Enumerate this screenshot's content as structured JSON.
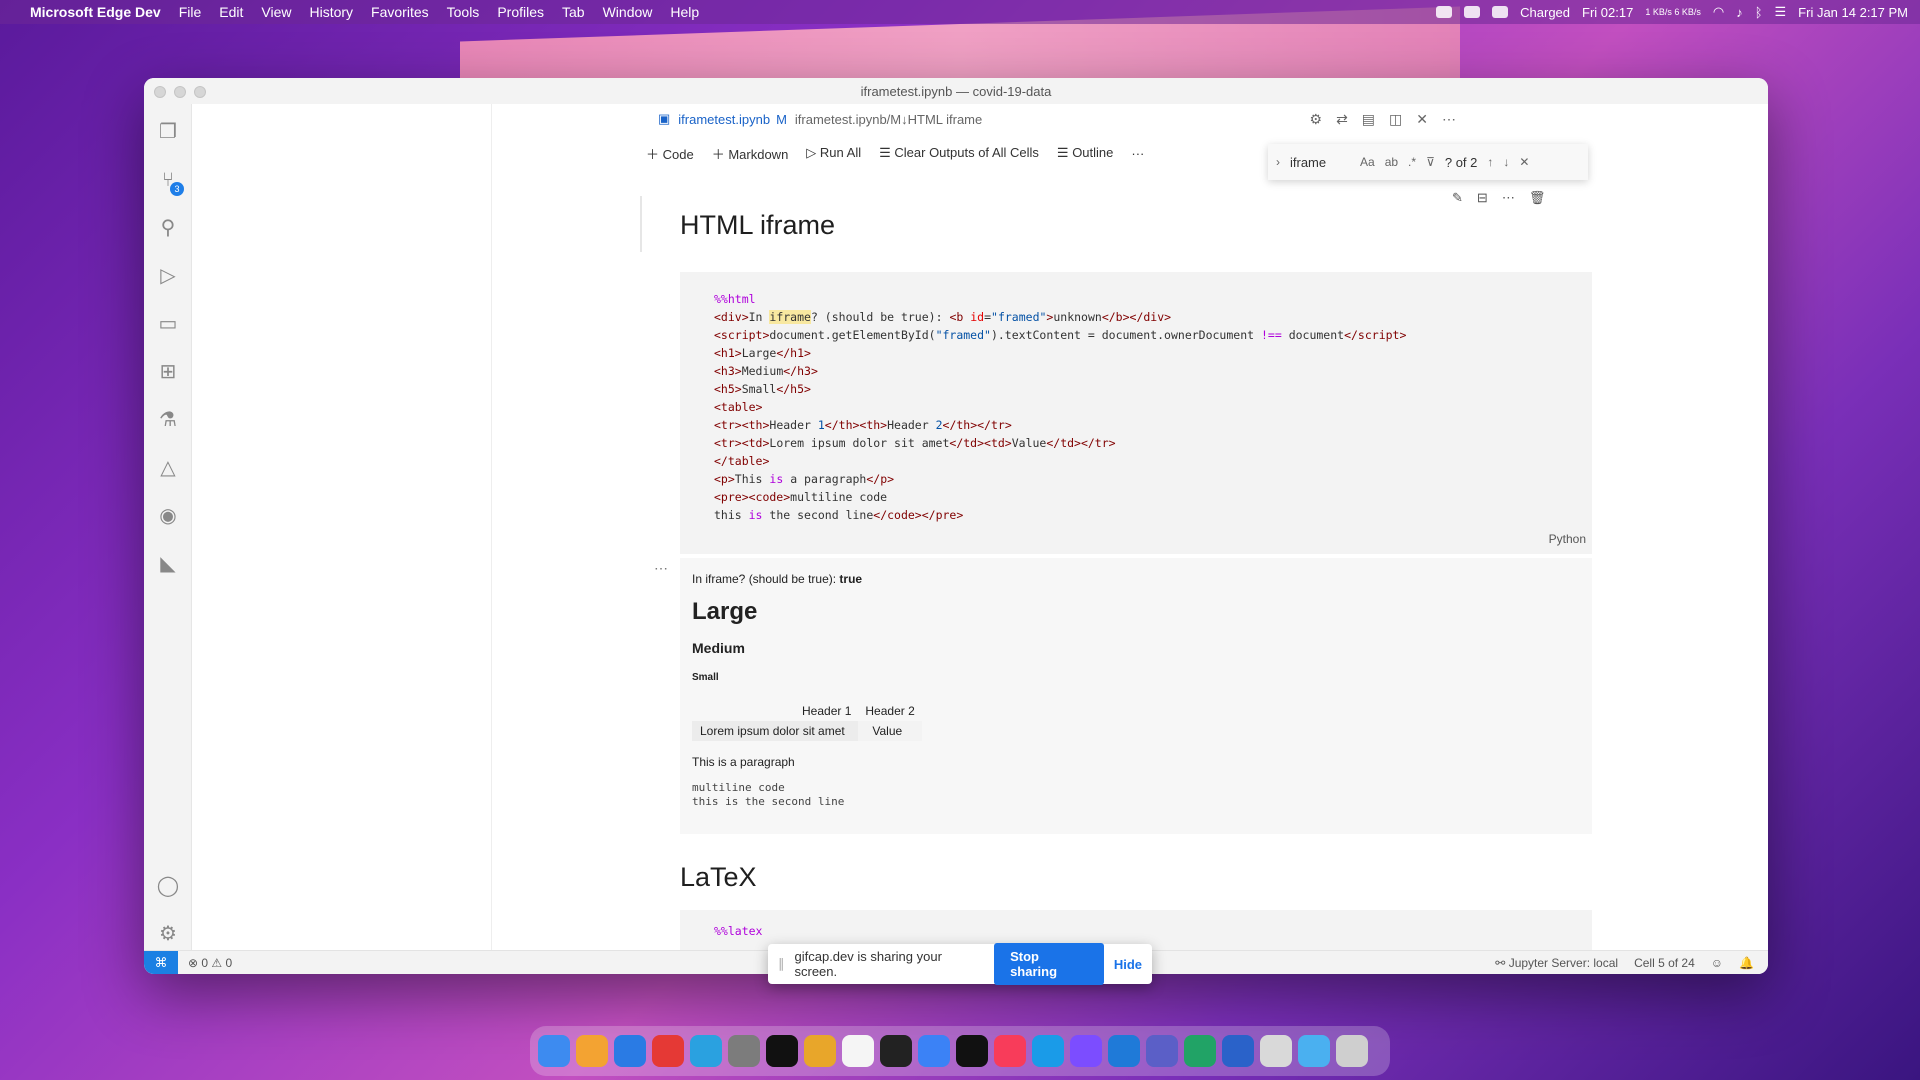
{
  "menubar": {
    "app_name": "Microsoft Edge Dev",
    "menus": [
      "File",
      "Edit",
      "View",
      "History",
      "Favorites",
      "Tools",
      "Profiles",
      "Tab",
      "Window",
      "Help"
    ],
    "battery_status": "Charged",
    "clock_short": "Fri 02:17",
    "net_speed": "1 KB/s 6 KB/s",
    "datetime": "Fri Jan 14  2:17 PM"
  },
  "window": {
    "title": "iframetest.ipynb — covid-19-data"
  },
  "tab": {
    "filename": "iframetest.ipynb",
    "modified": "M",
    "breadcrumb": "iframetest.ipynb/M↓HTML iframe"
  },
  "toolbar": {
    "code": "Code",
    "markdown": "Markdown",
    "run_all": "Run All",
    "clear_outputs": "Clear Outputs of All Cells",
    "outline": "Outline",
    "more": "···"
  },
  "find": {
    "query": "iframe",
    "count": "? of 2"
  },
  "cells": {
    "heading1": "HTML iframe",
    "language": "Python",
    "output": {
      "line_prefix": "In iframe? (should be true): ",
      "line_value": "true",
      "h1": "Large",
      "h3": "Medium",
      "h5": "Small",
      "table_headers": [
        "Header 1",
        "Header 2"
      ],
      "table_row": [
        "Lorem ipsum dolor sit amet",
        "Value"
      ],
      "paragraph": "This is a paragraph",
      "pre_lines": [
        "multiline code",
        "this is the second line"
      ]
    },
    "heading2": "LaTeX",
    "latex_first_line": "%%latex"
  },
  "statusbar": {
    "errors": "0",
    "warnings": "0",
    "jupyter": "Jupyter Server: local",
    "cell_pos": "Cell 5 of 24"
  },
  "share_bar": {
    "message": "gifcap.dev is sharing your screen.",
    "stop": "Stop sharing",
    "hide": "Hide"
  },
  "dock": {
    "app_colors": [
      "#3d8bf0",
      "#f3a332",
      "#2a7be4",
      "#e53935",
      "#2aa1e0",
      "#7c7c7c",
      "#111111",
      "#e8a62a",
      "#f5f5f5",
      "#222222",
      "#3b82f6",
      "#111111",
      "#f83c5a",
      "#1a9be8",
      "#7c4dff",
      "#1f7ad8",
      "#5b5fc7",
      "#21a366",
      "#2a62c9",
      "#d9d9d9",
      "#4ab0f0",
      "#cfcfcf"
    ]
  }
}
